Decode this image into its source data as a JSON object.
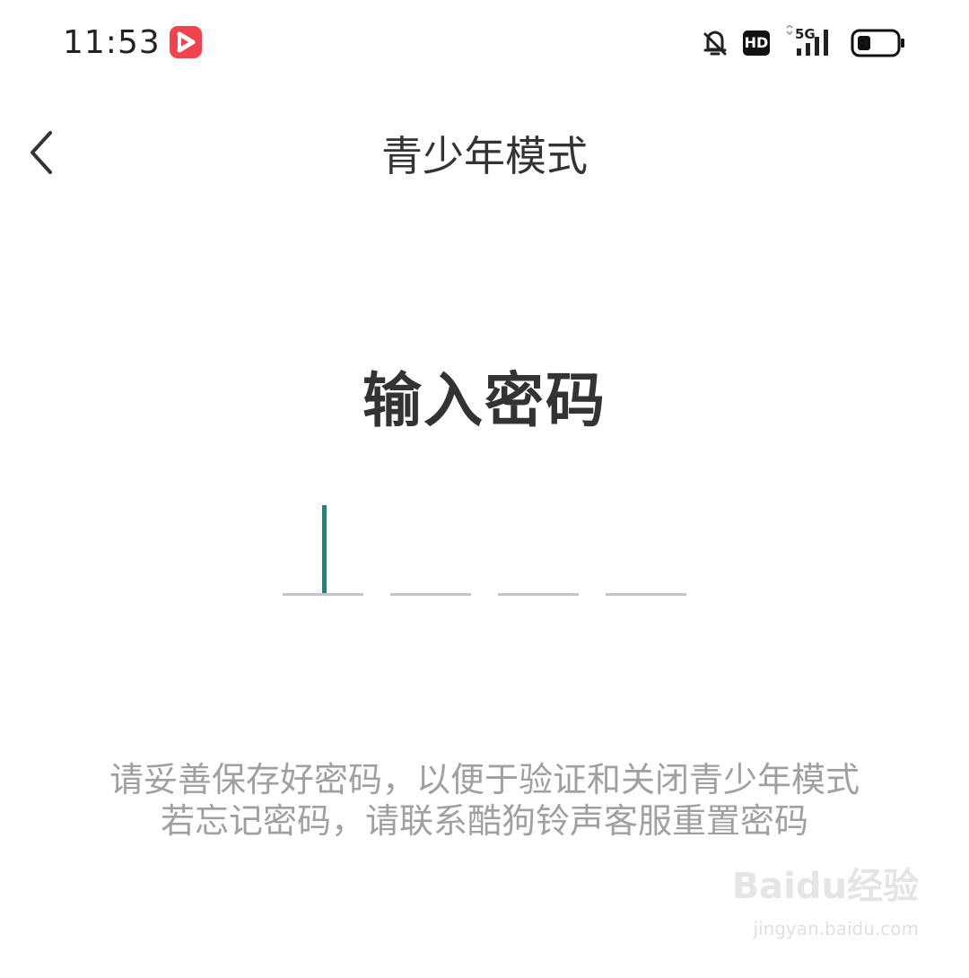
{
  "status_bar": {
    "time": "11:53",
    "network": "5G",
    "hd_label": "HD",
    "icons": [
      "app-badge-icon",
      "bell-off-icon",
      "hd-icon",
      "signal-5g-icon",
      "battery-icon"
    ],
    "app_badge_color": "#f2424c"
  },
  "nav": {
    "back_icon": "chevron-left-icon",
    "title": "青少年模式"
  },
  "main": {
    "heading": "输入密码",
    "pin": {
      "length": 4,
      "filled": 0,
      "active_index": 0,
      "cursor_color": "#12897a"
    },
    "hint_line1": "请妥善保存好密码，以便于验证和关闭青少年模式",
    "hint_line2": "若忘记密码，请联系酷狗铃声客服重置密码"
  },
  "watermark": {
    "brand": "Baidu经验",
    "url": "jingyan.baidu.com"
  }
}
